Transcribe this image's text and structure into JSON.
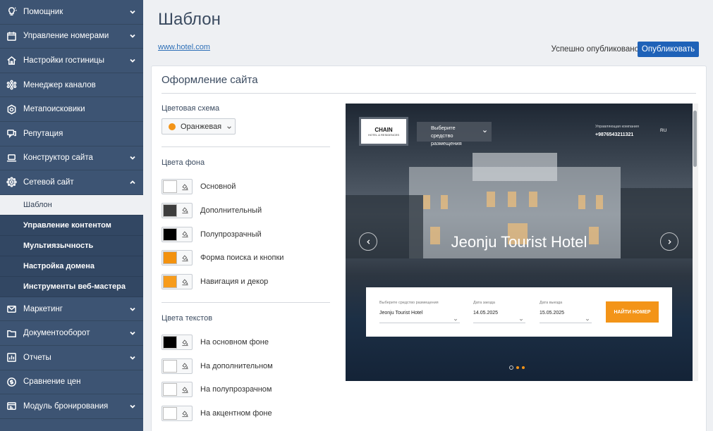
{
  "sidebar": {
    "items": [
      {
        "label": "Помощник",
        "icon": "lightbulb-icon",
        "chevron": "down"
      },
      {
        "label": "Управление номерами",
        "icon": "calendar-icon",
        "chevron": "down"
      },
      {
        "label": "Настройки гостиницы",
        "icon": "home-icon",
        "chevron": "down"
      },
      {
        "label": "Менеджер каналов",
        "icon": "network-icon",
        "chevron": ""
      },
      {
        "label": "Метапоисковики",
        "icon": "meta-search-icon",
        "chevron": ""
      },
      {
        "label": "Репутация",
        "icon": "chat-icon",
        "chevron": ""
      },
      {
        "label": "Конструктор сайта",
        "icon": "laptop-icon",
        "chevron": "down"
      },
      {
        "label": "Сетевой сайт",
        "icon": "sitemap-icon",
        "chevron": "up"
      }
    ],
    "subitems": [
      {
        "label": "Шаблон",
        "active": true
      },
      {
        "label": "Управление контентом",
        "active": false
      },
      {
        "label": "Мультиязычность",
        "active": false
      },
      {
        "label": "Настройка домена",
        "active": false
      },
      {
        "label": "Инструменты веб-мастера",
        "active": false
      }
    ],
    "items_after": [
      {
        "label": "Маркетинг",
        "icon": "mail-icon",
        "chevron": "down"
      },
      {
        "label": "Документооборот",
        "icon": "folder-icon",
        "chevron": "down"
      },
      {
        "label": "Отчеты",
        "icon": "report-icon",
        "chevron": "down"
      },
      {
        "label": "Сравнение цен",
        "icon": "price-icon",
        "chevron": ""
      },
      {
        "label": "Модуль бронирования",
        "icon": "booking-icon",
        "chevron": "down"
      }
    ]
  },
  "header": {
    "title": "Шаблон",
    "site_link": "www.hotel.com",
    "status": "Успешно опубликовано",
    "publish_label": "Опубликовать"
  },
  "design": {
    "title": "Оформление сайта",
    "scheme_label": "Цветовая схема",
    "scheme_value": "Оранжевая",
    "bg_label": "Цвета фона",
    "bg_colors": [
      {
        "name": "Основной",
        "color": "#ffffff"
      },
      {
        "name": "Дополнительный",
        "color": "#3d3d3d"
      },
      {
        "name": "Полупрозрачный",
        "color": "#000000"
      },
      {
        "name": "Форма поиска и кнопки",
        "color": "#f3920f"
      },
      {
        "name": "Навигация и декор",
        "color": "#f79c1c"
      }
    ],
    "text_label": "Цвета текстов",
    "text_colors": [
      {
        "name": "На основном фоне",
        "color": "#000000"
      },
      {
        "name": "На дополнительном",
        "color": "#ffffff"
      },
      {
        "name": "На полупрозрачном",
        "color": "#ffffff"
      },
      {
        "name": "На акцентном фоне",
        "color": "#ffffff"
      }
    ]
  },
  "preview": {
    "logo_main": "CHAIN",
    "logo_sub": "HOTEL & RESIDENCES",
    "select_placeholder": "Выберите средство размещения",
    "company_label": "Управляющая компания",
    "phone": "+9876543211321",
    "lang": "RU",
    "hotel_name": "Jeonju Tourist Hotel",
    "form": {
      "property_label": "Выберите средство размещения",
      "property_value": "Jeonju Tourist Hotel",
      "checkin_label": "Дата заезда",
      "checkin_value": "14.05.2025",
      "checkout_label": "Дата выезда",
      "checkout_value": "15.05.2025",
      "find_label": "НАЙТИ НОМЕР"
    }
  }
}
